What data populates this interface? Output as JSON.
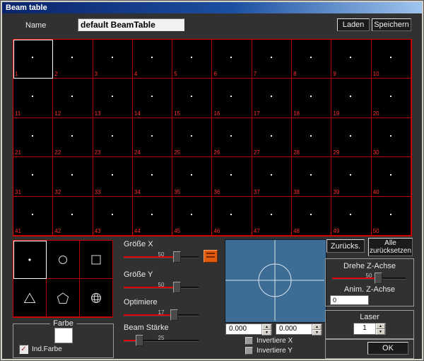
{
  "window": {
    "title": "Beam table"
  },
  "header": {
    "name_label": "Name",
    "name_value": "default BeamTable",
    "laden_button": "Laden",
    "speichern_button": "Speichern"
  },
  "beam_grid": {
    "count": 50,
    "selected": 1
  },
  "shape_selector": {
    "shapes": [
      "dot",
      "circle",
      "square",
      "triangle",
      "pentagon",
      "sphere"
    ],
    "selected": "dot"
  },
  "farbe_group": {
    "label": "Farbe",
    "ind_farbe_label": "Ind.Farbe",
    "ind_farbe_checked": true,
    "swatch_color": "#ffffff"
  },
  "sliders": {
    "groesse_x": {
      "label": "Größe X",
      "value": 50,
      "percent": 70
    },
    "groesse_y": {
      "label": "Größe Y",
      "value": 50,
      "percent": 70
    },
    "optimiere": {
      "label": "Optimiere",
      "value": 17,
      "percent": 66
    },
    "beam_staerke": {
      "label": "Beam Stärke",
      "value": 25,
      "percent": 20
    },
    "drehe_z": {
      "label": "Drehe Z-Achse",
      "value": 50,
      "percent": 62
    }
  },
  "preview": {
    "x_value": "0.000",
    "y_value": "0.000",
    "invert_x_label": "Invertiere X",
    "invert_y_label": "Invertiere Y",
    "invert_x_checked": false,
    "invert_y_checked": false,
    "background_color": "#3d6d94"
  },
  "right_panel": {
    "zurueck_button": "Zurücks.",
    "alle_zuruecksetzen_button": "Alle zurücksetzen",
    "anim_z_label": "Anim. Z-Achse",
    "anim_z_value": "0",
    "laser_label": "Laser",
    "laser_value": "1",
    "ok_button": "OK"
  },
  "icons": {
    "arrow_up": "▲",
    "arrow_down": "▼",
    "check": "✓"
  },
  "colors": {
    "grid_line": "#b80000",
    "accent_red": "#e00000",
    "titlebar_blue": "#0a246a"
  }
}
